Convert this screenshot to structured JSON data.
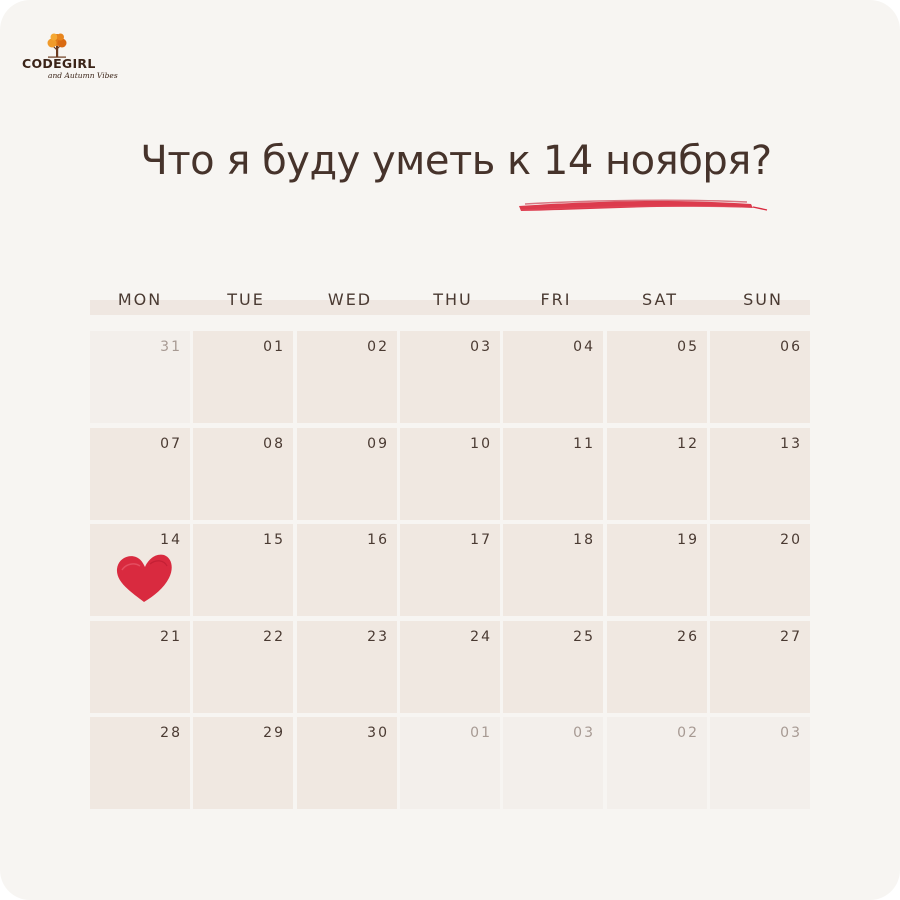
{
  "logo": {
    "brand": "CODEGIRL",
    "tagline": "and Autumn Vibes",
    "icon": "autumn-tree-icon"
  },
  "title": "Что я буду уметь к 14 ноября?",
  "colors": {
    "background": "#f7f5f2",
    "cell": "#f0e8e1",
    "cell_muted": "#f3efeb",
    "accent": "#d92a3f",
    "text": "#4a3a32"
  },
  "calendar": {
    "weekdays": [
      "MON",
      "TUE",
      "WED",
      "THU",
      "FRI",
      "SAT",
      "SUN"
    ],
    "weeks": [
      [
        {
          "day": "31",
          "muted": true
        },
        {
          "day": "01",
          "muted": false
        },
        {
          "day": "02",
          "muted": false
        },
        {
          "day": "03",
          "muted": false
        },
        {
          "day": "04",
          "muted": false
        },
        {
          "day": "05",
          "muted": false
        },
        {
          "day": "06",
          "muted": false
        }
      ],
      [
        {
          "day": "07",
          "muted": false
        },
        {
          "day": "08",
          "muted": false
        },
        {
          "day": "09",
          "muted": false
        },
        {
          "day": "10",
          "muted": false
        },
        {
          "day": "11",
          "muted": false
        },
        {
          "day": "12",
          "muted": false
        },
        {
          "day": "13",
          "muted": false
        }
      ],
      [
        {
          "day": "14",
          "muted": false,
          "marked": "heart-icon"
        },
        {
          "day": "15",
          "muted": false
        },
        {
          "day": "16",
          "muted": false
        },
        {
          "day": "17",
          "muted": false
        },
        {
          "day": "18",
          "muted": false
        },
        {
          "day": "19",
          "muted": false
        },
        {
          "day": "20",
          "muted": false
        }
      ],
      [
        {
          "day": "21",
          "muted": false
        },
        {
          "day": "22",
          "muted": false
        },
        {
          "day": "23",
          "muted": false
        },
        {
          "day": "24",
          "muted": false
        },
        {
          "day": "25",
          "muted": false
        },
        {
          "day": "26",
          "muted": false
        },
        {
          "day": "27",
          "muted": false
        }
      ],
      [
        {
          "day": "28",
          "muted": false
        },
        {
          "day": "29",
          "muted": false
        },
        {
          "day": "30",
          "muted": false
        },
        {
          "day": "01",
          "muted": true
        },
        {
          "day": "03",
          "muted": true
        },
        {
          "day": "02",
          "muted": true
        },
        {
          "day": "03",
          "muted": true
        }
      ]
    ]
  }
}
